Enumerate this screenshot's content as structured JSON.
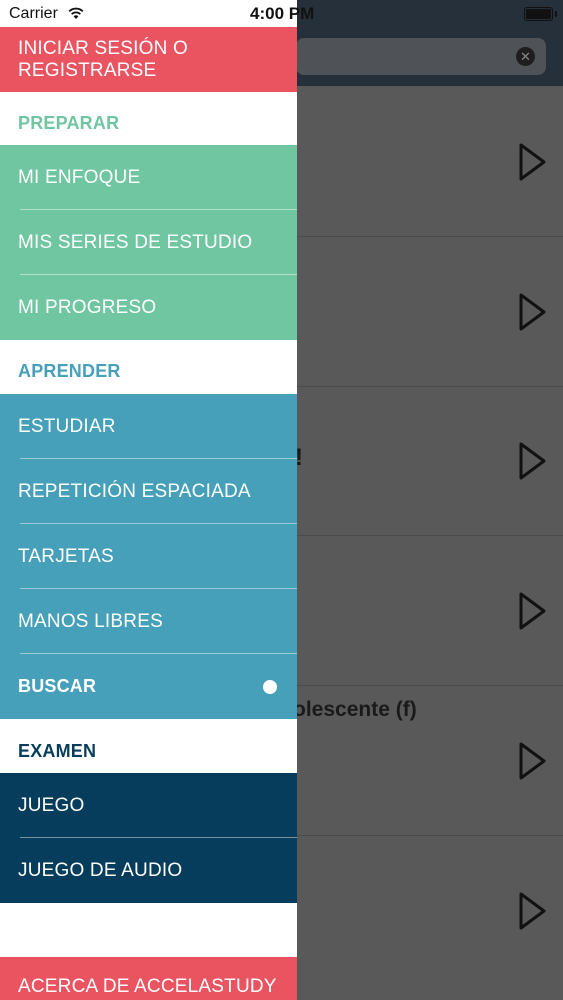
{
  "status_bar": {
    "carrier": "Carrier",
    "time": "4:00 PM"
  },
  "colors": {
    "red": "#ea5461",
    "green": "#6fc6a1",
    "blue": "#46a0ba",
    "navy": "#073d5c",
    "prepare_heading": "#6fc6a1",
    "learn_heading": "#46a0ba",
    "exam_heading": "#073d5c"
  },
  "drawer": {
    "login": "INICIAR SESIÓN O REGISTRARSE",
    "prepare": {
      "heading": "PREPARAR",
      "items": [
        {
          "label": "MI ENFOQUE"
        },
        {
          "label": "MIS SERIES DE ESTUDIO"
        },
        {
          "label": "MI PROGRESO"
        }
      ]
    },
    "learn": {
      "heading": "APRENDER",
      "items": [
        {
          "label": "ESTUDIAR"
        },
        {
          "label": "REPETICIÓN ESPACIADA"
        },
        {
          "label": "TARJETAS"
        },
        {
          "label": "MANOS LIBRES"
        },
        {
          "label": "BUSCAR"
        }
      ]
    },
    "exam": {
      "heading": "EXAMEN",
      "items": [
        {
          "label": "JUEGO"
        },
        {
          "label": "JUEGO DE AUDIO"
        }
      ]
    },
    "about": "ACERCA DE ACCELASTUDY"
  },
  "background": {
    "search_clear_icon": "clear-icon",
    "row_fragment_text": "olescente (f)",
    "partial_glyph": "!",
    "play_icon": "play-icon"
  }
}
